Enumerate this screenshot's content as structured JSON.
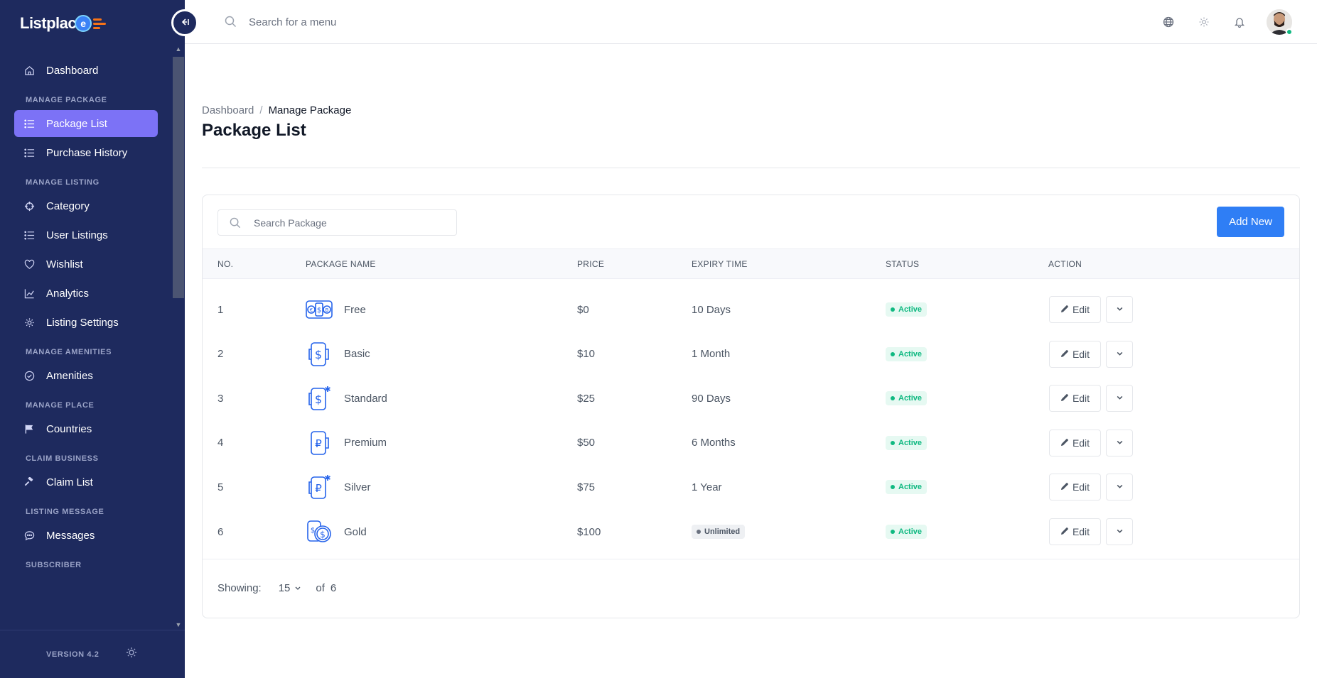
{
  "app": {
    "logo_text": "Listplac",
    "logo_mark": "e",
    "version": "VERSION 4.2"
  },
  "sidebar": {
    "items": [
      {
        "type": "item",
        "label": "Dashboard",
        "icon": "home-icon"
      },
      {
        "type": "section",
        "label": "MANAGE PACKAGE"
      },
      {
        "type": "item",
        "label": "Package List",
        "icon": "list-icon",
        "active": true
      },
      {
        "type": "item",
        "label": "Purchase History",
        "icon": "list-icon"
      },
      {
        "type": "section",
        "label": "MANAGE LISTING"
      },
      {
        "type": "item",
        "label": "Category",
        "icon": "crosshair-icon"
      },
      {
        "type": "item",
        "label": "User Listings",
        "icon": "list-icon"
      },
      {
        "type": "item",
        "label": "Wishlist",
        "icon": "heart-icon"
      },
      {
        "type": "item",
        "label": "Analytics",
        "icon": "chart-line-icon"
      },
      {
        "type": "item",
        "label": "Listing Settings",
        "icon": "gear-icon"
      },
      {
        "type": "section",
        "label": "MANAGE AMENITIES"
      },
      {
        "type": "item",
        "label": "Amenities",
        "icon": "check-circle-icon"
      },
      {
        "type": "section",
        "label": "MANAGE PLACE"
      },
      {
        "type": "item",
        "label": "Countries",
        "icon": "flag-icon"
      },
      {
        "type": "section",
        "label": "CLAIM BUSINESS"
      },
      {
        "type": "item",
        "label": "Claim List",
        "icon": "gavel-icon"
      },
      {
        "type": "section",
        "label": "LISTING MESSAGE"
      },
      {
        "type": "item",
        "label": "Messages",
        "icon": "message-icon"
      },
      {
        "type": "section",
        "label": "SUBSCRIBER"
      }
    ]
  },
  "topbar": {
    "search_placeholder": "Search for a menu"
  },
  "breadcrumb": {
    "home": "Dashboard",
    "separator": "/",
    "current": "Manage Package"
  },
  "page": {
    "title": "Package List"
  },
  "toolbar": {
    "search_placeholder": "Search Package",
    "add_label": "Add New"
  },
  "table": {
    "headers": {
      "no": "NO.",
      "name": "PACKAGE NAME",
      "price": "PRICE",
      "expiry": "EXPIRY TIME",
      "status": "STATUS",
      "action": "ACTION"
    },
    "edit_label": "Edit",
    "rows": [
      {
        "no": "1",
        "name": "Free",
        "price": "$0",
        "expiry": "10 Days",
        "expiry_badge": false,
        "status": "Active",
        "icon": "currencies-icon"
      },
      {
        "no": "2",
        "name": "Basic",
        "price": "$10",
        "expiry": "1 Month",
        "expiry_badge": false,
        "status": "Active",
        "icon": "dollar-phone-icon"
      },
      {
        "no": "3",
        "name": "Standard",
        "price": "$25",
        "expiry": "90 Days",
        "expiry_badge": false,
        "status": "Active",
        "icon": "dollar-star-icon"
      },
      {
        "no": "4",
        "name": "Premium",
        "price": "$50",
        "expiry": "6 Months",
        "expiry_badge": false,
        "status": "Active",
        "icon": "ruble-phone-icon"
      },
      {
        "no": "5",
        "name": "Silver",
        "price": "$75",
        "expiry": "1 Year",
        "expiry_badge": false,
        "status": "Active",
        "icon": "ruble-star-icon"
      },
      {
        "no": "6",
        "name": "Gold",
        "price": "$100",
        "expiry": "Unlimited",
        "expiry_badge": true,
        "status": "Active",
        "icon": "coins-icon"
      }
    ]
  },
  "pagination": {
    "showing_label": "Showing:",
    "per_page": "15",
    "of_label": "of",
    "total": "6"
  },
  "colors": {
    "sidebar_bg": "#1e2a5e",
    "active_item": "#7c72f6",
    "primary": "#2f7ef5",
    "success": "#10b981"
  }
}
